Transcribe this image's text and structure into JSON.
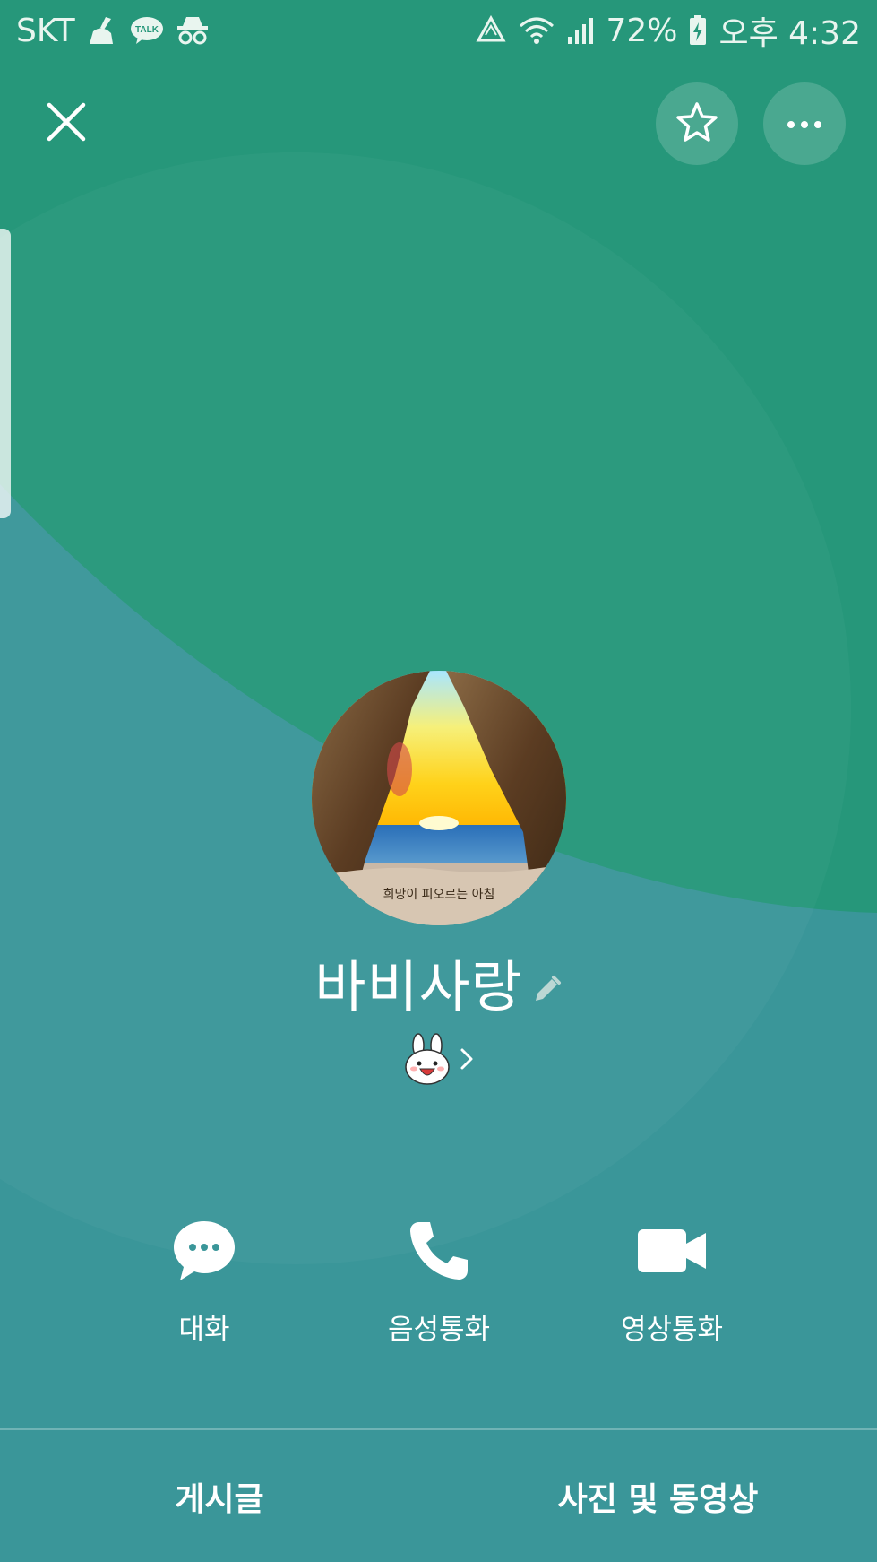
{
  "status_bar": {
    "carrier": "SKT",
    "battery": "72%",
    "time": "오후 4:32",
    "left_icons": [
      "broom-icon",
      "kakaotalk-icon",
      "incognito-icon"
    ],
    "left_icon_text": "TALK",
    "right_icons": [
      "data-saver-icon",
      "wifi-icon",
      "signal-icon",
      "battery-charging-icon"
    ]
  },
  "top_bar": {
    "close_icon": "close-icon",
    "favorite_icon": "star-icon",
    "more_icon": "more-dots-icon"
  },
  "profile": {
    "name": "바비사랑",
    "edit_icon": "pencil-icon",
    "status_icon": "bunny-emoticon-icon",
    "avatar_caption": "희망이 피오르는 아침"
  },
  "actions": [
    {
      "label": "대화",
      "icon": "chat-bubble-icon"
    },
    {
      "label": "음성통화",
      "icon": "phone-icon"
    },
    {
      "label": "영상통화",
      "icon": "video-camera-icon"
    }
  ],
  "tabs": [
    {
      "label": "게시글"
    },
    {
      "label": "사진 및 동영상"
    }
  ],
  "colors": {
    "background_green": "#26977a",
    "background_teal": "#3a9699",
    "text": "#ffffff"
  }
}
